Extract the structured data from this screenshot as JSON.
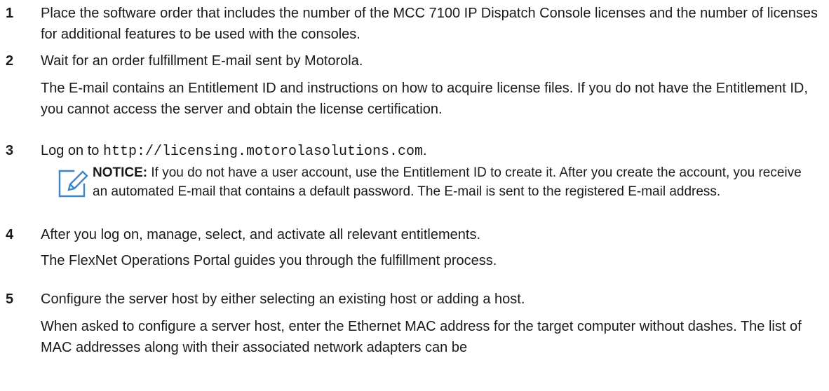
{
  "steps": [
    {
      "number": "1",
      "text": "Place the software order that includes the number of the MCC 7100 IP Dispatch Console licenses and the number of licenses for additional features to be used with the consoles."
    },
    {
      "number": "2",
      "text": "Wait for an order fulfillment E-mail sent by Motorola.",
      "detail": "The E-mail contains an Entitlement ID and instructions on how to acquire license files. If you do not have the Entitlement ID, you cannot access the server and obtain the license certification."
    },
    {
      "number": "3",
      "text_prefix": "Log on to ",
      "url": "http://licensing.motorolasolutions.com",
      "text_suffix": "."
    },
    {
      "number": "4",
      "text": "After you log on, manage, select, and activate all relevant entitlements.",
      "detail": "The FlexNet Operations Portal guides you through the fulfillment process."
    },
    {
      "number": "5",
      "text": "Configure the server host by either selecting an existing host or adding a host.",
      "detail": "When asked to configure a server host, enter the Ethernet MAC address for the target computer without dashes. The list of MAC addresses along with their associated network adapters can be"
    }
  ],
  "notice": {
    "icon": "edit-note-icon",
    "label": "NOTICE:",
    "text": " If you do not have a user account, use the Entitlement ID to create it. After you create the account, you receive an automated E-mail that contains a default password. The E-mail is sent to the registered E-mail address."
  },
  "colors": {
    "icon_blue": "#3a86c8"
  }
}
